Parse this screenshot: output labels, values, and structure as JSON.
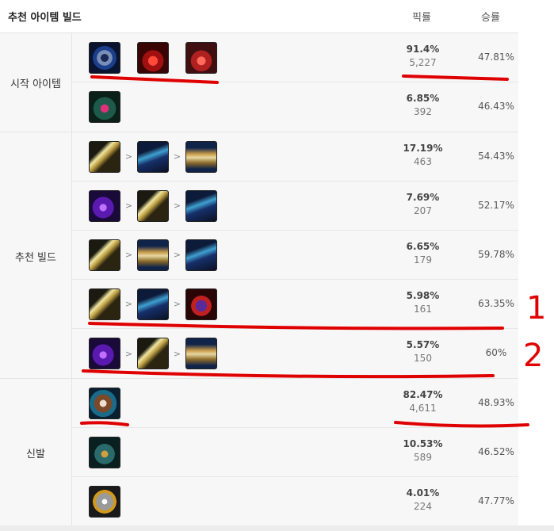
{
  "header": {
    "title": "추천 아이템 빌드",
    "pick_col": "픽률",
    "win_col": "승률"
  },
  "sections": {
    "start": {
      "label": "시작 아이템",
      "rows": [
        {
          "items": [
            "ring-icon",
            "health-potion-icon",
            "refillable-potion-icon"
          ],
          "pick_rate": "91.4%",
          "count": "5,227",
          "win_rate": "47.81%"
        },
        {
          "items": [
            "corrupting-potion-icon"
          ],
          "pick_rate": "6.85%",
          "count": "392",
          "win_rate": "46.43%"
        }
      ]
    },
    "build": {
      "label": "추천 빌드",
      "rows": [
        {
          "items": [
            "sword-icon",
            "tome-icon",
            "hourglass-icon"
          ],
          "pick_rate": "17.19%",
          "count": "463",
          "win_rate": "54.43%"
        },
        {
          "items": [
            "wand-icon",
            "sword-icon",
            "tome-icon"
          ],
          "pick_rate": "7.69%",
          "count": "207",
          "win_rate": "52.17%"
        },
        {
          "items": [
            "sword-icon",
            "hourglass-icon",
            "tome-icon"
          ],
          "pick_rate": "6.65%",
          "count": "179",
          "win_rate": "59.78%"
        },
        {
          "items": [
            "sword-icon",
            "tome-icon",
            "wizard-hat-icon"
          ],
          "pick_rate": "5.98%",
          "count": "161",
          "win_rate": "63.35%"
        },
        {
          "items": [
            "wand-icon",
            "sword-icon",
            "hourglass-icon"
          ],
          "pick_rate": "5.57%",
          "count": "150",
          "win_rate": "60%"
        }
      ]
    },
    "boots": {
      "label": "신발",
      "rows": [
        {
          "items": [
            "sorcerer-boots-icon"
          ],
          "pick_rate": "82.47%",
          "count": "4,611",
          "win_rate": "48.93%"
        },
        {
          "items": [
            "mercury-treads-icon"
          ],
          "pick_rate": "10.53%",
          "count": "589",
          "win_rate": "46.52%"
        },
        {
          "items": [
            "ionian-boots-icon"
          ],
          "pick_rate": "4.01%",
          "count": "224",
          "win_rate": "47.77%"
        }
      ]
    }
  },
  "annotations": {
    "mark_1": "1",
    "mark_2": "2",
    "ink_color": "#e00000"
  }
}
